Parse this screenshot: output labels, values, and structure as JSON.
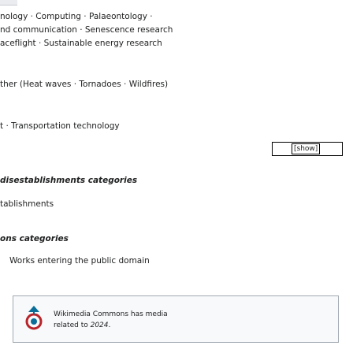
{
  "lines": {
    "l1": "nology · Computing · Palaeontology ·",
    "l2": "nd communication · Senescence research",
    "l3": "aceflight · Sustainable energy research",
    "l4": "ther (Heat waves · Tornadoes · Wildfires)",
    "l5": "t · Transportation technology"
  },
  "toggle": {
    "label": "[show]"
  },
  "sections": {
    "disestablishments_heading": "disestablishments categories",
    "disestablishments_item": "tablishments",
    "works_heading": "ons categories",
    "works_item": "Works entering the public domain"
  },
  "commons": {
    "line1": "Wikimedia Commons has media",
    "line2_prefix": "related to ",
    "line2_year": "2024",
    "line2_suffix": "."
  }
}
